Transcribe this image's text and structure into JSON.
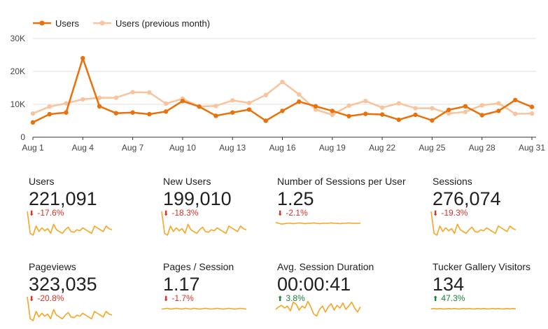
{
  "chart_data": {
    "type": "line",
    "x": [
      "Aug 1",
      "Aug 2",
      "Aug 3",
      "Aug 4",
      "Aug 5",
      "Aug 6",
      "Aug 7",
      "Aug 8",
      "Aug 9",
      "Aug 10",
      "Aug 11",
      "Aug 12",
      "Aug 13",
      "Aug 14",
      "Aug 15",
      "Aug 16",
      "Aug 17",
      "Aug 18",
      "Aug 19",
      "Aug 20",
      "Aug 21",
      "Aug 22",
      "Aug 23",
      "Aug 24",
      "Aug 25",
      "Aug 26",
      "Aug 27",
      "Aug 28",
      "Aug 29",
      "Aug 30",
      "Aug 31"
    ],
    "x_tick_labels": [
      "Aug 1",
      "Aug 4",
      "Aug 7",
      "Aug 10",
      "Aug 13",
      "Aug 16",
      "Aug 19",
      "Aug 22",
      "Aug 25",
      "Aug 28",
      "Aug 31"
    ],
    "y_tick_labels": [
      "0",
      "10K",
      "20K",
      "30K"
    ],
    "ylim": [
      0,
      30000
    ],
    "grid": true,
    "legend_position": "top-left",
    "series": [
      {
        "name": "Users",
        "color": "#e8710a",
        "values": [
          4500,
          7000,
          7500,
          24000,
          9400,
          7300,
          7500,
          7000,
          7800,
          11000,
          9300,
          6500,
          7500,
          8400,
          5000,
          8000,
          10800,
          9400,
          8000,
          6400,
          7100,
          6900,
          5300,
          6800,
          5100,
          8300,
          9400,
          6700,
          8000,
          11300,
          9200
        ]
      },
      {
        "name": "Users (previous month)",
        "color": "#f8c49d",
        "values": [
          7200,
          9300,
          10300,
          11500,
          12000,
          12000,
          13700,
          13600,
          10200,
          11700,
          9300,
          9500,
          11200,
          10400,
          12800,
          16800,
          13000,
          8400,
          6800,
          9600,
          11000,
          9000,
          10300,
          8800,
          8800,
          7200,
          7700,
          9700,
          10300,
          7100,
          7200
        ]
      }
    ]
  },
  "kpis": [
    {
      "label": "Users",
      "value": "221,091",
      "change": "-17.6%",
      "direction": "down",
      "spark": [
        95,
        35,
        30,
        55,
        40,
        50,
        42,
        48,
        35,
        60,
        45,
        40,
        35,
        45,
        52,
        40,
        38,
        45,
        42,
        50,
        45,
        40,
        35,
        55,
        50,
        45,
        40,
        55,
        48,
        45
      ]
    },
    {
      "label": "New Users",
      "value": "199,010",
      "change": "-18.3%",
      "direction": "down",
      "spark": [
        95,
        35,
        30,
        55,
        40,
        50,
        42,
        48,
        35,
        60,
        45,
        40,
        35,
        45,
        52,
        40,
        38,
        45,
        42,
        50,
        45,
        40,
        35,
        55,
        50,
        45,
        40,
        55,
        48,
        45
      ]
    },
    {
      "label": "Number of Sessions per User",
      "value": "1.25",
      "change": "-2.1%",
      "direction": "down",
      "spark": [
        52,
        50,
        48,
        49,
        50,
        50,
        49,
        50,
        51,
        50,
        49,
        50,
        50,
        51,
        50,
        49,
        50,
        50,
        50,
        51,
        50,
        50,
        49,
        50,
        50,
        51,
        50,
        50,
        50,
        50
      ]
    },
    {
      "label": "Sessions",
      "value": "276,074",
      "change": "-19.3%",
      "direction": "down",
      "spark": [
        95,
        35,
        30,
        55,
        40,
        50,
        42,
        48,
        35,
        60,
        45,
        40,
        35,
        45,
        52,
        40,
        38,
        45,
        42,
        50,
        45,
        40,
        35,
        55,
        50,
        45,
        40,
        55,
        48,
        45
      ]
    },
    {
      "label": "Pageviews",
      "value": "323,035",
      "change": "-20.8%",
      "direction": "down",
      "spark": [
        95,
        35,
        30,
        55,
        40,
        50,
        42,
        48,
        35,
        60,
        45,
        40,
        35,
        45,
        52,
        40,
        38,
        45,
        42,
        50,
        45,
        40,
        35,
        55,
        50,
        45,
        40,
        55,
        48,
        45
      ]
    },
    {
      "label": "Pages / Session",
      "value": "1.17",
      "change": "-1.7%",
      "direction": "down",
      "spark": [
        50,
        51,
        52,
        50,
        51,
        52,
        51,
        50,
        52,
        51,
        50,
        52,
        51,
        50,
        51,
        52,
        51,
        50,
        51,
        52,
        51,
        50,
        51,
        52,
        51,
        50,
        51,
        52,
        51,
        50
      ]
    },
    {
      "label": "Avg. Session Duration",
      "value": "00:00:41",
      "change": "3.8%",
      "direction": "up",
      "spark": [
        52,
        58,
        62,
        55,
        60,
        48,
        70,
        65,
        50,
        60,
        55,
        72,
        58,
        40,
        35,
        52,
        60,
        45,
        58,
        66,
        50,
        62,
        55,
        68,
        52,
        60,
        70,
        55,
        45,
        58
      ]
    },
    {
      "label": "Tucker Gallery Visitors",
      "value": "134",
      "change": "47.3%",
      "direction": "up",
      "spark": [
        50,
        51,
        50,
        51,
        50,
        50,
        51,
        50,
        51,
        50,
        50,
        51,
        50,
        51,
        50,
        50,
        51,
        50,
        51,
        50,
        50,
        51,
        50,
        51,
        50,
        50,
        51,
        50,
        51,
        50
      ]
    }
  ]
}
